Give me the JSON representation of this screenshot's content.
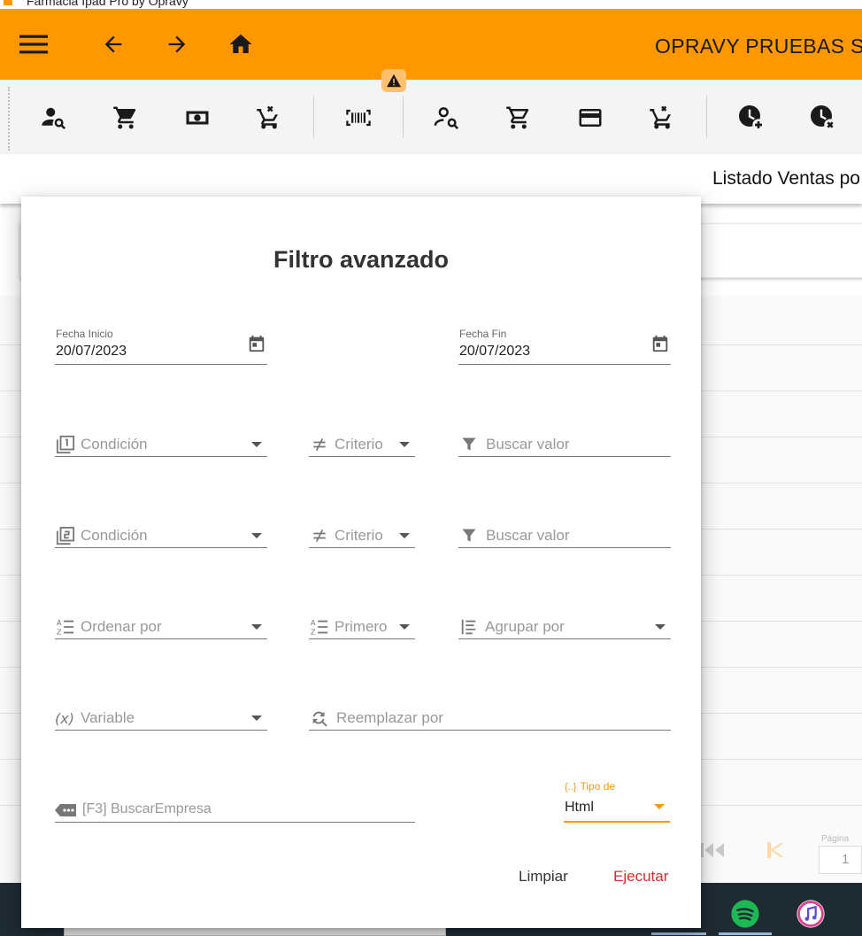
{
  "window": {
    "title": "Farmacia Ipad Pro by Opravy"
  },
  "appbar": {
    "title": "OPRAVY PRUEBAS S",
    "icons": [
      "menu-icon",
      "arrow-back-icon",
      "arrow-forward-icon",
      "home-icon"
    ]
  },
  "toolbar": {
    "icons": [
      "person-search-icon",
      "cart-icon",
      "cash-icon",
      "cart-remove-icon",
      "barcode-icon",
      "person-search-outline-icon",
      "cart-outline-icon",
      "credit-card-icon",
      "cart-remove-outline-icon",
      "clock-plus-icon",
      "clock-remove-icon"
    ],
    "warning_icon": "warning-icon"
  },
  "background": {
    "page_title": "Listado Ventas po",
    "pager_label": "Página",
    "pager_value": "1"
  },
  "dialog": {
    "title": "Filtro avanzado",
    "fecha_inicio": {
      "label": "Fecha Inicio",
      "value": "20/07/2023"
    },
    "fecha_fin": {
      "label": "Fecha Fin",
      "value": "20/07/2023"
    },
    "row1": {
      "condicion": "Condición",
      "criterio": "Criterio",
      "buscar": "Buscar valor"
    },
    "row2": {
      "condicion": "Condición",
      "criterio": "Criterio",
      "buscar": "Buscar valor"
    },
    "ordenar": "Ordenar por",
    "primero": "Primero",
    "agrupar": "Agrupar por",
    "variable": "Variable",
    "reemplazar": "Reemplazar por",
    "buscar_empresa": "[F3] BuscarEmpresa",
    "tipo": {
      "label": "Tipo de",
      "value": "Html",
      "icon_text": "{..}"
    },
    "limpiar": "Limpiar",
    "ejecutar": "Ejecutar"
  },
  "colors": {
    "primary": "#ff9800",
    "danger": "#d32f2f"
  }
}
